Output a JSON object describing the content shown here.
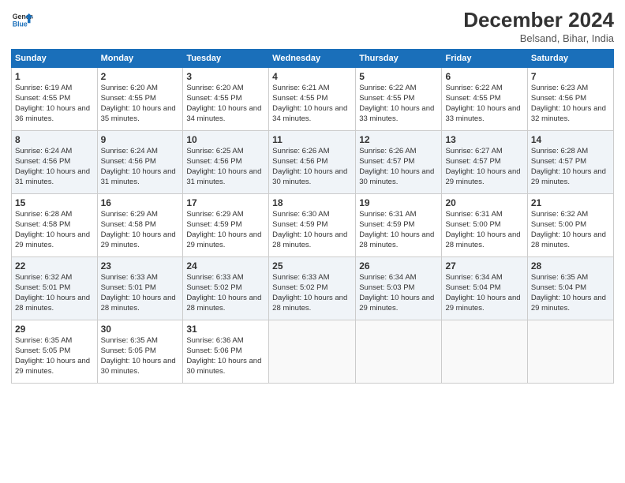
{
  "logo": {
    "line1": "General",
    "line2": "Blue"
  },
  "title": "December 2024",
  "subtitle": "Belsand, Bihar, India",
  "days_of_week": [
    "Sunday",
    "Monday",
    "Tuesday",
    "Wednesday",
    "Thursday",
    "Friday",
    "Saturday"
  ],
  "weeks": [
    [
      {
        "day": 1,
        "sunrise": "6:19 AM",
        "sunset": "4:55 PM",
        "daylight": "10 hours and 36 minutes."
      },
      {
        "day": 2,
        "sunrise": "6:20 AM",
        "sunset": "4:55 PM",
        "daylight": "10 hours and 35 minutes."
      },
      {
        "day": 3,
        "sunrise": "6:20 AM",
        "sunset": "4:55 PM",
        "daylight": "10 hours and 34 minutes."
      },
      {
        "day": 4,
        "sunrise": "6:21 AM",
        "sunset": "4:55 PM",
        "daylight": "10 hours and 34 minutes."
      },
      {
        "day": 5,
        "sunrise": "6:22 AM",
        "sunset": "4:55 PM",
        "daylight": "10 hours and 33 minutes."
      },
      {
        "day": 6,
        "sunrise": "6:22 AM",
        "sunset": "4:55 PM",
        "daylight": "10 hours and 33 minutes."
      },
      {
        "day": 7,
        "sunrise": "6:23 AM",
        "sunset": "4:56 PM",
        "daylight": "10 hours and 32 minutes."
      }
    ],
    [
      {
        "day": 8,
        "sunrise": "6:24 AM",
        "sunset": "4:56 PM",
        "daylight": "10 hours and 31 minutes."
      },
      {
        "day": 9,
        "sunrise": "6:24 AM",
        "sunset": "4:56 PM",
        "daylight": "10 hours and 31 minutes."
      },
      {
        "day": 10,
        "sunrise": "6:25 AM",
        "sunset": "4:56 PM",
        "daylight": "10 hours and 31 minutes."
      },
      {
        "day": 11,
        "sunrise": "6:26 AM",
        "sunset": "4:56 PM",
        "daylight": "10 hours and 30 minutes."
      },
      {
        "day": 12,
        "sunrise": "6:26 AM",
        "sunset": "4:57 PM",
        "daylight": "10 hours and 30 minutes."
      },
      {
        "day": 13,
        "sunrise": "6:27 AM",
        "sunset": "4:57 PM",
        "daylight": "10 hours and 29 minutes."
      },
      {
        "day": 14,
        "sunrise": "6:28 AM",
        "sunset": "4:57 PM",
        "daylight": "10 hours and 29 minutes."
      }
    ],
    [
      {
        "day": 15,
        "sunrise": "6:28 AM",
        "sunset": "4:58 PM",
        "daylight": "10 hours and 29 minutes."
      },
      {
        "day": 16,
        "sunrise": "6:29 AM",
        "sunset": "4:58 PM",
        "daylight": "10 hours and 29 minutes."
      },
      {
        "day": 17,
        "sunrise": "6:29 AM",
        "sunset": "4:59 PM",
        "daylight": "10 hours and 29 minutes."
      },
      {
        "day": 18,
        "sunrise": "6:30 AM",
        "sunset": "4:59 PM",
        "daylight": "10 hours and 28 minutes."
      },
      {
        "day": 19,
        "sunrise": "6:31 AM",
        "sunset": "4:59 PM",
        "daylight": "10 hours and 28 minutes."
      },
      {
        "day": 20,
        "sunrise": "6:31 AM",
        "sunset": "5:00 PM",
        "daylight": "10 hours and 28 minutes."
      },
      {
        "day": 21,
        "sunrise": "6:32 AM",
        "sunset": "5:00 PM",
        "daylight": "10 hours and 28 minutes."
      }
    ],
    [
      {
        "day": 22,
        "sunrise": "6:32 AM",
        "sunset": "5:01 PM",
        "daylight": "10 hours and 28 minutes."
      },
      {
        "day": 23,
        "sunrise": "6:33 AM",
        "sunset": "5:01 PM",
        "daylight": "10 hours and 28 minutes."
      },
      {
        "day": 24,
        "sunrise": "6:33 AM",
        "sunset": "5:02 PM",
        "daylight": "10 hours and 28 minutes."
      },
      {
        "day": 25,
        "sunrise": "6:33 AM",
        "sunset": "5:02 PM",
        "daylight": "10 hours and 28 minutes."
      },
      {
        "day": 26,
        "sunrise": "6:34 AM",
        "sunset": "5:03 PM",
        "daylight": "10 hours and 29 minutes."
      },
      {
        "day": 27,
        "sunrise": "6:34 AM",
        "sunset": "5:04 PM",
        "daylight": "10 hours and 29 minutes."
      },
      {
        "day": 28,
        "sunrise": "6:35 AM",
        "sunset": "5:04 PM",
        "daylight": "10 hours and 29 minutes."
      }
    ],
    [
      {
        "day": 29,
        "sunrise": "6:35 AM",
        "sunset": "5:05 PM",
        "daylight": "10 hours and 29 minutes."
      },
      {
        "day": 30,
        "sunrise": "6:35 AM",
        "sunset": "5:05 PM",
        "daylight": "10 hours and 30 minutes."
      },
      {
        "day": 31,
        "sunrise": "6:36 AM",
        "sunset": "5:06 PM",
        "daylight": "10 hours and 30 minutes."
      },
      null,
      null,
      null,
      null
    ]
  ]
}
